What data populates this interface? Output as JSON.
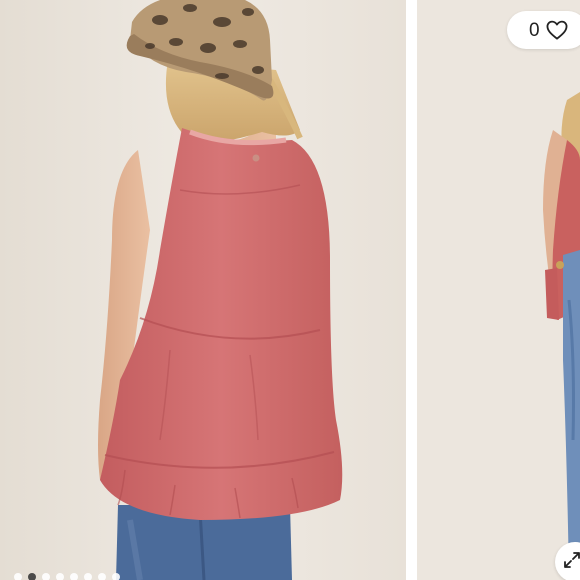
{
  "listing": {
    "like_count": "0",
    "like_icon": "heart-outline-icon",
    "expand_icon": "expand-arrows-icon"
  },
  "carousel": {
    "slide_count": 8,
    "active_index": 1
  },
  "colors": {
    "background": "#ebe5dd",
    "top_color": "#cf6a6a",
    "denim": "#4b6b9a",
    "hat_base": "#b89a74"
  }
}
